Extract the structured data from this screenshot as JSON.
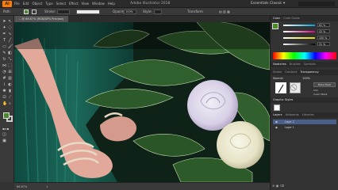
{
  "menubar": {
    "app_icon": "Ai",
    "menus": [
      "File",
      "Edit",
      "Object",
      "Type",
      "Select",
      "Effect",
      "View",
      "Window",
      "Help"
    ],
    "title": "Adobe Illustrator 2018",
    "workspace": "Essentials Classic ▾"
  },
  "controlbar": {
    "selection_label": "Path",
    "stroke_label": "Stroke:",
    "opacity_label": "Opacity:",
    "opacity_value": "100%",
    "style_label": "Style:",
    "transform_label": "Transform"
  },
  "document": {
    "tab_title": "…@ 66.67% (RGB/GPU Preview)"
  },
  "statusbar": {
    "zoom": "66.67%",
    "artboard": "1"
  },
  "color_panel": {
    "tabs": [
      "Color",
      "Color Guide"
    ],
    "values": [
      "62 %",
      "43 %",
      "100 %",
      "31 %"
    ],
    "colors": {
      "accent": "#4a8a2a",
      "c": "#00a0d6",
      "m": "#d6007d",
      "y": "#e0d600",
      "k": "#000000"
    }
  },
  "swatch_panels": {
    "tabs": [
      "Swatches",
      "Brushes",
      "Symbols"
    ]
  },
  "stroke_panel": {
    "tabs": [
      "Stroke",
      "Gradient",
      "Transparency"
    ],
    "blend_mode": "Normal",
    "opacity": "100%",
    "make_mask": "Make Mask",
    "clip": "Clip",
    "invert": "Invert Mask"
  },
  "graphic_styles": {
    "label": "Graphic Styles"
  },
  "layers_panel": {
    "tabs": [
      "Layers",
      "Artboards",
      "Libraries"
    ],
    "layers": [
      "Layer 2",
      "Layer 1"
    ]
  }
}
